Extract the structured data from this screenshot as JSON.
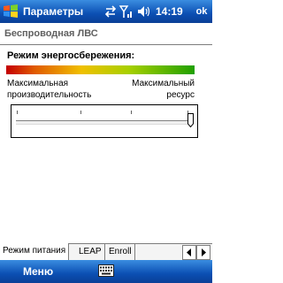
{
  "title_bar": {
    "title": "Параметры",
    "clock": "14:19",
    "ok_label": "ok",
    "icons": [
      "windows-start-icon",
      "connectivity-icon",
      "signal-icon",
      "volume-icon"
    ]
  },
  "section": {
    "title": "Беспроводная ЛВС"
  },
  "power_mode": {
    "heading": "Режим энергосбережения:",
    "left_label_line1": "Максимальная",
    "left_label_line2": "производительность",
    "right_label_line1": "Максимальный",
    "right_label_line2": "ресурс",
    "slider_value_fraction": 1.0,
    "gradient_colors": [
      "#c40000",
      "#f0c000",
      "#20a000"
    ]
  },
  "tabs": [
    {
      "label": "Режим питания",
      "active": true
    },
    {
      "label": "LEAP",
      "active": false
    },
    {
      "label": "Enroll",
      "active": false
    }
  ],
  "menu_bar": {
    "menu_label": "Меню",
    "icon": "keyboard-icon"
  },
  "colors": {
    "bar_blue": "#0b4fb3",
    "accent": "#3a8de0"
  }
}
